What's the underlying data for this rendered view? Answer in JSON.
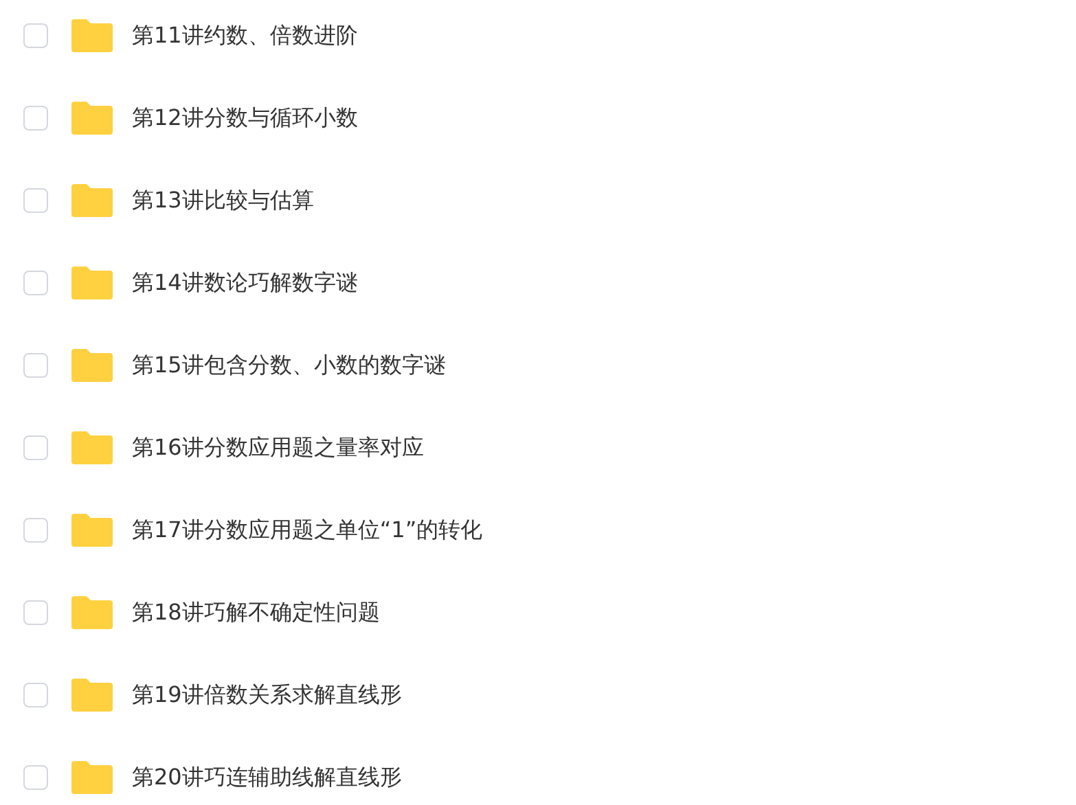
{
  "folders": [
    {
      "name": "第11讲约数、倍数进阶",
      "checked": false
    },
    {
      "name": "第12讲分数与循环小数",
      "checked": false
    },
    {
      "name": "第13讲比较与估算",
      "checked": false
    },
    {
      "name": "第14讲数论巧解数字谜",
      "checked": false
    },
    {
      "name": "第15讲包含分数、小数的数字谜",
      "checked": false
    },
    {
      "name": "第16讲分数应用题之量率对应",
      "checked": false
    },
    {
      "name": "第17讲分数应用题之单位“1”的转化",
      "checked": false
    },
    {
      "name": "第18讲巧解不确定性问题",
      "checked": false
    },
    {
      "name": "第19讲倍数关系求解直线形",
      "checked": false
    },
    {
      "name": "第20讲巧连辅助线解直线形",
      "checked": false
    }
  ]
}
